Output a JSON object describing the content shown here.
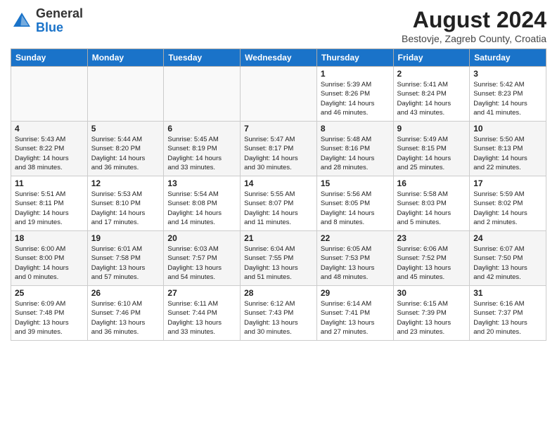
{
  "logo": {
    "general": "General",
    "blue": "Blue"
  },
  "title": "August 2024",
  "location": "Bestovje, Zagreb County, Croatia",
  "weekdays": [
    "Sunday",
    "Monday",
    "Tuesday",
    "Wednesday",
    "Thursday",
    "Friday",
    "Saturday"
  ],
  "weeks": [
    [
      {
        "day": "",
        "info": ""
      },
      {
        "day": "",
        "info": ""
      },
      {
        "day": "",
        "info": ""
      },
      {
        "day": "",
        "info": ""
      },
      {
        "day": "1",
        "info": "Sunrise: 5:39 AM\nSunset: 8:26 PM\nDaylight: 14 hours\nand 46 minutes."
      },
      {
        "day": "2",
        "info": "Sunrise: 5:41 AM\nSunset: 8:24 PM\nDaylight: 14 hours\nand 43 minutes."
      },
      {
        "day": "3",
        "info": "Sunrise: 5:42 AM\nSunset: 8:23 PM\nDaylight: 14 hours\nand 41 minutes."
      }
    ],
    [
      {
        "day": "4",
        "info": "Sunrise: 5:43 AM\nSunset: 8:22 PM\nDaylight: 14 hours\nand 38 minutes."
      },
      {
        "day": "5",
        "info": "Sunrise: 5:44 AM\nSunset: 8:20 PM\nDaylight: 14 hours\nand 36 minutes."
      },
      {
        "day": "6",
        "info": "Sunrise: 5:45 AM\nSunset: 8:19 PM\nDaylight: 14 hours\nand 33 minutes."
      },
      {
        "day": "7",
        "info": "Sunrise: 5:47 AM\nSunset: 8:17 PM\nDaylight: 14 hours\nand 30 minutes."
      },
      {
        "day": "8",
        "info": "Sunrise: 5:48 AM\nSunset: 8:16 PM\nDaylight: 14 hours\nand 28 minutes."
      },
      {
        "day": "9",
        "info": "Sunrise: 5:49 AM\nSunset: 8:15 PM\nDaylight: 14 hours\nand 25 minutes."
      },
      {
        "day": "10",
        "info": "Sunrise: 5:50 AM\nSunset: 8:13 PM\nDaylight: 14 hours\nand 22 minutes."
      }
    ],
    [
      {
        "day": "11",
        "info": "Sunrise: 5:51 AM\nSunset: 8:11 PM\nDaylight: 14 hours\nand 19 minutes."
      },
      {
        "day": "12",
        "info": "Sunrise: 5:53 AM\nSunset: 8:10 PM\nDaylight: 14 hours\nand 17 minutes."
      },
      {
        "day": "13",
        "info": "Sunrise: 5:54 AM\nSunset: 8:08 PM\nDaylight: 14 hours\nand 14 minutes."
      },
      {
        "day": "14",
        "info": "Sunrise: 5:55 AM\nSunset: 8:07 PM\nDaylight: 14 hours\nand 11 minutes."
      },
      {
        "day": "15",
        "info": "Sunrise: 5:56 AM\nSunset: 8:05 PM\nDaylight: 14 hours\nand 8 minutes."
      },
      {
        "day": "16",
        "info": "Sunrise: 5:58 AM\nSunset: 8:03 PM\nDaylight: 14 hours\nand 5 minutes."
      },
      {
        "day": "17",
        "info": "Sunrise: 5:59 AM\nSunset: 8:02 PM\nDaylight: 14 hours\nand 2 minutes."
      }
    ],
    [
      {
        "day": "18",
        "info": "Sunrise: 6:00 AM\nSunset: 8:00 PM\nDaylight: 14 hours\nand 0 minutes."
      },
      {
        "day": "19",
        "info": "Sunrise: 6:01 AM\nSunset: 7:58 PM\nDaylight: 13 hours\nand 57 minutes."
      },
      {
        "day": "20",
        "info": "Sunrise: 6:03 AM\nSunset: 7:57 PM\nDaylight: 13 hours\nand 54 minutes."
      },
      {
        "day": "21",
        "info": "Sunrise: 6:04 AM\nSunset: 7:55 PM\nDaylight: 13 hours\nand 51 minutes."
      },
      {
        "day": "22",
        "info": "Sunrise: 6:05 AM\nSunset: 7:53 PM\nDaylight: 13 hours\nand 48 minutes."
      },
      {
        "day": "23",
        "info": "Sunrise: 6:06 AM\nSunset: 7:52 PM\nDaylight: 13 hours\nand 45 minutes."
      },
      {
        "day": "24",
        "info": "Sunrise: 6:07 AM\nSunset: 7:50 PM\nDaylight: 13 hours\nand 42 minutes."
      }
    ],
    [
      {
        "day": "25",
        "info": "Sunrise: 6:09 AM\nSunset: 7:48 PM\nDaylight: 13 hours\nand 39 minutes."
      },
      {
        "day": "26",
        "info": "Sunrise: 6:10 AM\nSunset: 7:46 PM\nDaylight: 13 hours\nand 36 minutes."
      },
      {
        "day": "27",
        "info": "Sunrise: 6:11 AM\nSunset: 7:44 PM\nDaylight: 13 hours\nand 33 minutes."
      },
      {
        "day": "28",
        "info": "Sunrise: 6:12 AM\nSunset: 7:43 PM\nDaylight: 13 hours\nand 30 minutes."
      },
      {
        "day": "29",
        "info": "Sunrise: 6:14 AM\nSunset: 7:41 PM\nDaylight: 13 hours\nand 27 minutes."
      },
      {
        "day": "30",
        "info": "Sunrise: 6:15 AM\nSunset: 7:39 PM\nDaylight: 13 hours\nand 23 minutes."
      },
      {
        "day": "31",
        "info": "Sunrise: 6:16 AM\nSunset: 7:37 PM\nDaylight: 13 hours\nand 20 minutes."
      }
    ]
  ]
}
